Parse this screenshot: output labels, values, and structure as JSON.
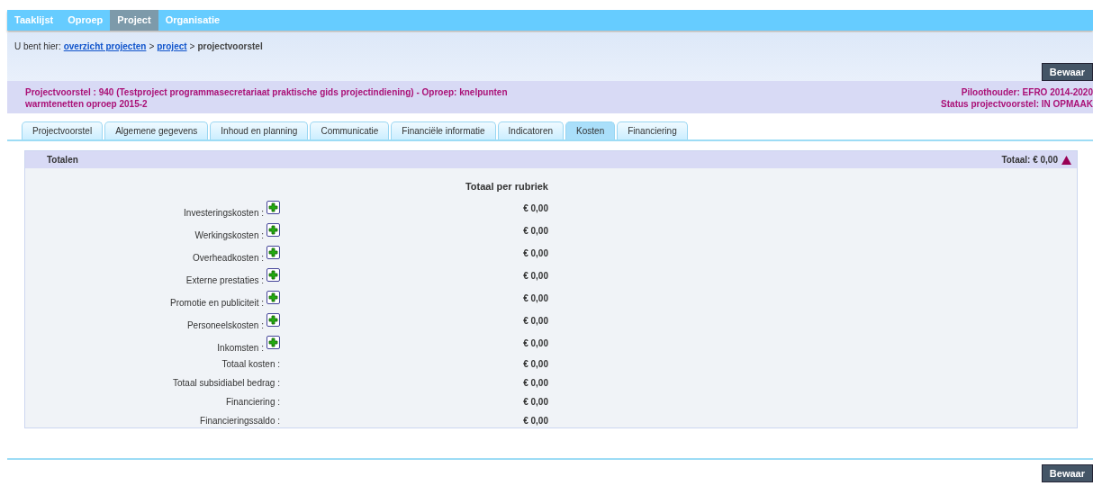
{
  "nav": [
    {
      "label": "Taaklijst",
      "selected": false
    },
    {
      "label": "Oproep",
      "selected": false
    },
    {
      "label": "Project",
      "selected": true
    },
    {
      "label": "Organisatie",
      "selected": false
    }
  ],
  "breadcrumb": {
    "prefix": "U bent hier:",
    "links": [
      "overzicht projecten",
      "project"
    ],
    "separator": ">",
    "current": "projectvoorstel"
  },
  "save_button": "Bewaar",
  "header": {
    "title": "Projectvoorstel : 940 (Testproject programmasecretariaat praktische gids projectindiening) - Oproep: knelpunten warmtenetten oproep 2015-2",
    "owner": "Piloothouder: EFRO 2014-2020",
    "status": "Status projectvoorstel: IN OPMAAK"
  },
  "tabs": [
    {
      "label": "Projectvoorstel",
      "selected": false
    },
    {
      "label": "Algemene gegevens",
      "selected": false
    },
    {
      "label": "Inhoud en planning",
      "selected": false
    },
    {
      "label": "Communicatie",
      "selected": false
    },
    {
      "label": "Financiële informatie",
      "selected": false
    },
    {
      "label": "Indicatoren",
      "selected": false
    },
    {
      "label": "Kosten",
      "selected": true
    },
    {
      "label": "Financiering",
      "selected": false
    }
  ],
  "panel": {
    "title": "Totalen",
    "total": "Totaal: € 0,00",
    "expanded": true,
    "column_heading": "Totaal per rubriek",
    "rows": [
      {
        "kind": "addable",
        "label": "Investeringskosten :",
        "value": "€ 0,00"
      },
      {
        "kind": "addable",
        "label": "Werkingskosten :",
        "value": "€ 0,00"
      },
      {
        "kind": "addable",
        "label": "Overheadkosten :",
        "value": "€ 0,00"
      },
      {
        "kind": "addable",
        "label": "Externe prestaties :",
        "value": "€ 0,00"
      },
      {
        "kind": "addable",
        "label": "Promotie en publiciteit :",
        "value": "€ 0,00"
      },
      {
        "kind": "addable",
        "label": "Personeelskosten :",
        "value": "€ 0,00"
      },
      {
        "kind": "addable",
        "label": "Inkomsten :",
        "value": "€ 0,00"
      },
      {
        "kind": "total",
        "label": "Totaal kosten :",
        "value": "€ 0,00"
      },
      {
        "kind": "total",
        "label": "Totaal subsidiabel bedrag :",
        "value": "€ 0,00"
      },
      {
        "kind": "total",
        "label": "Financiering :",
        "value": "€ 0,00"
      },
      {
        "kind": "total",
        "label": "Financieringssaldo :",
        "value": "€ 0,00"
      }
    ]
  },
  "footer_button": "Bewaar"
}
